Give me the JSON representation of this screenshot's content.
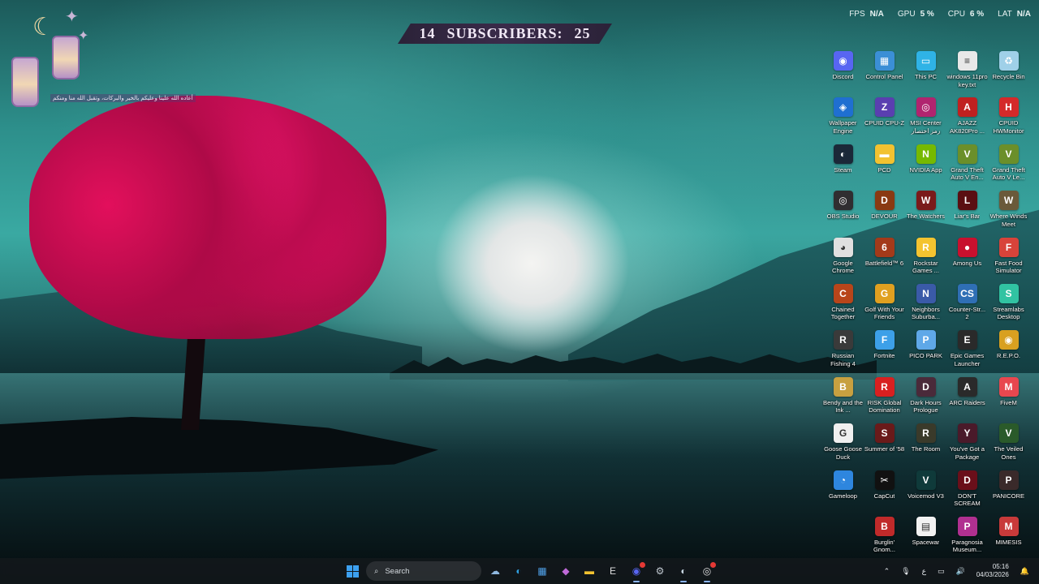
{
  "overlay": {
    "subscribers": {
      "left": "14",
      "label": "SUBSCRIBERS:",
      "right": "25"
    },
    "perf": [
      {
        "label": "FPS",
        "value": "N/A"
      },
      {
        "label": "GPU",
        "value": "5 %"
      },
      {
        "label": "CPU",
        "value": "6 %"
      },
      {
        "label": "LAT",
        "value": "N/A"
      }
    ],
    "greeting": "أعاده الله علينا وعليكم بالخير والبركات، وتقبل الله منا ومنكم"
  },
  "desktop": {
    "icons": [
      {
        "label": "Discord",
        "color": "#5865f2",
        "glyph": "◉"
      },
      {
        "label": "Control Panel",
        "color": "#3b8fd6",
        "glyph": "▦"
      },
      {
        "label": "This PC",
        "color": "#2fb3e6",
        "glyph": "▭"
      },
      {
        "label": "windows 11pro key.txt",
        "color": "#e8e8e8",
        "glyph": "≡"
      },
      {
        "label": "Recycle Bin",
        "color": "#9fd0e8",
        "glyph": "♻"
      },
      {
        "label": "Wallpaper Engine",
        "color": "#1f6fd1",
        "glyph": "◈"
      },
      {
        "label": "CPUID CPU-Z",
        "color": "#5a3fb0",
        "glyph": "Z"
      },
      {
        "label": "MSI Center رمز اختصار",
        "color": "#b0246f",
        "glyph": "◎"
      },
      {
        "label": "AJAZZ AK820Pro ...",
        "color": "#c02020",
        "glyph": "A"
      },
      {
        "label": "CPUID HWMonitor",
        "color": "#d42a2a",
        "glyph": "H"
      },
      {
        "label": "Steam",
        "color": "#1b2838",
        "glyph": "◐"
      },
      {
        "label": "PCD",
        "color": "#f2c230",
        "glyph": "▬"
      },
      {
        "label": "NVIDIA App",
        "color": "#76b900",
        "glyph": "N"
      },
      {
        "label": "Grand Theft Auto V En...",
        "color": "#6b8f2a",
        "glyph": "V"
      },
      {
        "label": "Grand Theft Auto V Le...",
        "color": "#6b8f2a",
        "glyph": "V"
      },
      {
        "label": "OBS Studio",
        "color": "#302e31",
        "glyph": "◎"
      },
      {
        "label": "DEVOUR",
        "color": "#8a3a12",
        "glyph": "D"
      },
      {
        "label": "The Watchers",
        "color": "#7a1a1a",
        "glyph": "W"
      },
      {
        "label": "Liar's Bar",
        "color": "#5a0f12",
        "glyph": "L"
      },
      {
        "label": "Where Winds Meet",
        "color": "#6a5a3a",
        "glyph": "W"
      },
      {
        "label": "Google Chrome",
        "color": "#e0e0e0",
        "glyph": "◕"
      },
      {
        "label": "Battlefield™ 6",
        "color": "#a33a1a",
        "glyph": "6"
      },
      {
        "label": "Rockstar Games ...",
        "color": "#f4c430",
        "glyph": "R"
      },
      {
        "label": "Among Us",
        "color": "#c8102e",
        "glyph": "●"
      },
      {
        "label": "Fast Food Simulator",
        "color": "#d8433a",
        "glyph": "F"
      },
      {
        "label": "Chained Together",
        "color": "#b8451a",
        "glyph": "C"
      },
      {
        "label": "Golf With Your Friends",
        "color": "#e0a020",
        "glyph": "G"
      },
      {
        "label": "Neighbors Suburba...",
        "color": "#3a5aa8",
        "glyph": "N"
      },
      {
        "label": "Counter-Str... 2",
        "color": "#2f6fb5",
        "glyph": "CS"
      },
      {
        "label": "Streamlabs Desktop",
        "color": "#31c3a2",
        "glyph": "S"
      },
      {
        "label": "Russian Fishing 4",
        "color": "#3a3a3a",
        "glyph": "R"
      },
      {
        "label": "Fortnite",
        "color": "#3da0e8",
        "glyph": "F"
      },
      {
        "label": "PICO PARK",
        "color": "#5fa8e8",
        "glyph": "P"
      },
      {
        "label": "Epic Games Launcher",
        "color": "#2a2a2a",
        "glyph": "E"
      },
      {
        "label": "R.E.P.O.",
        "color": "#d8a020",
        "glyph": "◉"
      },
      {
        "label": "Bendy and the Ink ...",
        "color": "#c8a040",
        "glyph": "B"
      },
      {
        "label": "RISK Global Domination",
        "color": "#d82020",
        "glyph": "R"
      },
      {
        "label": "Dark Hours Prologue",
        "color": "#4a2a3a",
        "glyph": "D"
      },
      {
        "label": "ARC Raiders",
        "color": "#2a2a2a",
        "glyph": "A"
      },
      {
        "label": "FiveM",
        "color": "#e8474f",
        "glyph": "M"
      },
      {
        "label": "Goose Goose Duck",
        "color": "#f0f0f0",
        "glyph": "G"
      },
      {
        "label": "Summer of '58",
        "color": "#6a1a1a",
        "glyph": "S"
      },
      {
        "label": "The Room",
        "color": "#3a3a2a",
        "glyph": "R"
      },
      {
        "label": "You've Got a Package",
        "color": "#4a1a2a",
        "glyph": "Y"
      },
      {
        "label": "The Veiled Ones",
        "color": "#2a5a2a",
        "glyph": "V"
      },
      {
        "label": "Gameloop",
        "color": "#2e86de",
        "glyph": "◔"
      },
      {
        "label": "CapCut",
        "color": "#111111",
        "glyph": "✂"
      },
      {
        "label": "Voicemod V3",
        "color": "#0f3a3a",
        "glyph": "V"
      },
      {
        "label": "DON'T SCREAM",
        "color": "#6a0f1a",
        "glyph": "D"
      },
      {
        "label": "PANICORE",
        "color": "#3a2a2a",
        "glyph": "P"
      },
      {
        "label": "",
        "color": "transparent",
        "glyph": ""
      },
      {
        "label": "Burglin' Gnom...",
        "color": "#c02a2a",
        "glyph": "B"
      },
      {
        "label": "Spacewar",
        "color": "#f2f2f2",
        "glyph": "▤"
      },
      {
        "label": "Paragnosia Museum...",
        "color": "#b03090",
        "glyph": "P"
      },
      {
        "label": "MIMESIS",
        "color": "#c83a3a",
        "glyph": "M"
      }
    ]
  },
  "taskbar": {
    "search_placeholder": "Search",
    "apps": [
      {
        "name": "widgets-icon",
        "glyph": "☁",
        "color": "#8fb8e0"
      },
      {
        "name": "edge-icon",
        "glyph": "◐",
        "color": "#2fa0e0"
      },
      {
        "name": "store-icon",
        "glyph": "▦",
        "color": "#4fa0e8"
      },
      {
        "name": "copilot-icon",
        "glyph": "◆",
        "color": "#c06ad8"
      },
      {
        "name": "file-explorer-icon",
        "glyph": "▬",
        "color": "#f2c230"
      },
      {
        "name": "epic-games-icon",
        "glyph": "E",
        "color": "#dddddd"
      },
      {
        "name": "discord-icon",
        "glyph": "◉",
        "color": "#5865f2"
      },
      {
        "name": "settings-icon",
        "glyph": "⚙",
        "color": "#c0c8d0"
      },
      {
        "name": "steam-icon",
        "glyph": "◐",
        "color": "#c7d5e0"
      },
      {
        "name": "obs-icon",
        "glyph": "◎",
        "color": "#e0e0e0"
      }
    ],
    "tray": {
      "language": "ع",
      "time": "05:16",
      "date": "04/03/2026"
    }
  }
}
